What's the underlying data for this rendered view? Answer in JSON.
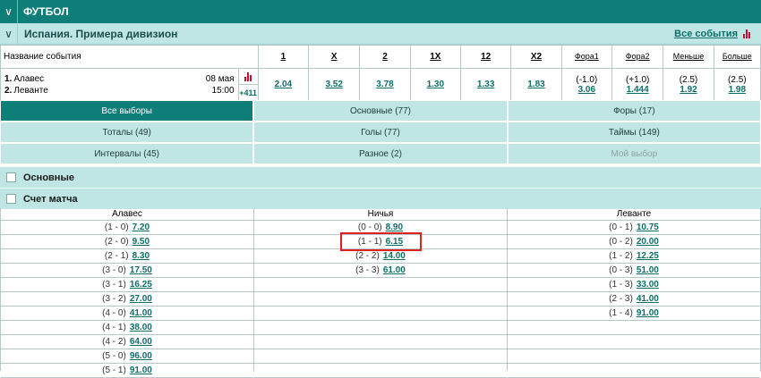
{
  "sport": {
    "title": "ФУТБОЛ",
    "chevron": "chevron-down-icon"
  },
  "league": {
    "title": "Испания. Примера дивизион",
    "all_events": "Все события"
  },
  "odds_header": {
    "name": "Название события",
    "cols": [
      "1",
      "X",
      "2",
      "1X",
      "12",
      "X2",
      "Фора1",
      "Фора2",
      "Меньше",
      "Больше"
    ]
  },
  "event": {
    "team1_num": "1.",
    "team1": "Алавес",
    "date": "08 мая",
    "team2_num": "2.",
    "team2": "Леванте",
    "time": "15:00",
    "more": "+411",
    "odds": [
      "2.04",
      "3.52",
      "3.78",
      "1.30",
      "1.33",
      "1.83"
    ],
    "fora1_hcp": "(-1.0)",
    "fora1_val": "3.06",
    "fora2_hcp": "(+1.0)",
    "fora2_val": "1.444",
    "under_hcp": "(2.5)",
    "under_val": "1.92",
    "over_hcp": "(2.5)",
    "over_val": "1.98"
  },
  "tabs": [
    [
      "Все выборы",
      "Основные (77)",
      "Форы (17)"
    ],
    [
      "Тоталы (49)",
      "Голы (77)",
      "Таймы (149)"
    ],
    [
      "Интервалы (45)",
      "Разное (2)",
      "Мой выбор"
    ]
  ],
  "sections": {
    "main": "Основные",
    "score": "Счет матча"
  },
  "score": {
    "headers": [
      "Алавес",
      "Ничья",
      "Леванте"
    ],
    "home": [
      [
        "(1 - 0)",
        "7.20"
      ],
      [
        "(2 - 0)",
        "9.50"
      ],
      [
        "(2 - 1)",
        "8.30"
      ],
      [
        "(3 - 0)",
        "17.50"
      ],
      [
        "(3 - 1)",
        "16.25"
      ],
      [
        "(3 - 2)",
        "27.00"
      ],
      [
        "(4 - 0)",
        "41.00"
      ],
      [
        "(4 - 1)",
        "38.00"
      ],
      [
        "(4 - 2)",
        "64.00"
      ],
      [
        "(5 - 0)",
        "96.00"
      ],
      [
        "(5 - 1)",
        "91.00"
      ]
    ],
    "draw": [
      [
        "(0 - 0)",
        "8.90"
      ],
      [
        "(1 - 1)",
        "6.15"
      ],
      [
        "(2 - 2)",
        "14.00"
      ],
      [
        "(3 - 3)",
        "61.00"
      ]
    ],
    "away": [
      [
        "(0 - 1)",
        "10.75"
      ],
      [
        "(0 - 2)",
        "20.00"
      ],
      [
        "(1 - 2)",
        "12.25"
      ],
      [
        "(0 - 3)",
        "51.00"
      ],
      [
        "(1 - 3)",
        "33.00"
      ],
      [
        "(2 - 3)",
        "41.00"
      ],
      [
        "(1 - 4)",
        "91.00"
      ]
    ]
  },
  "colors": {
    "primary": "#0f7d78",
    "light": "#bfe6e4",
    "highlight": "#e0201d"
  }
}
